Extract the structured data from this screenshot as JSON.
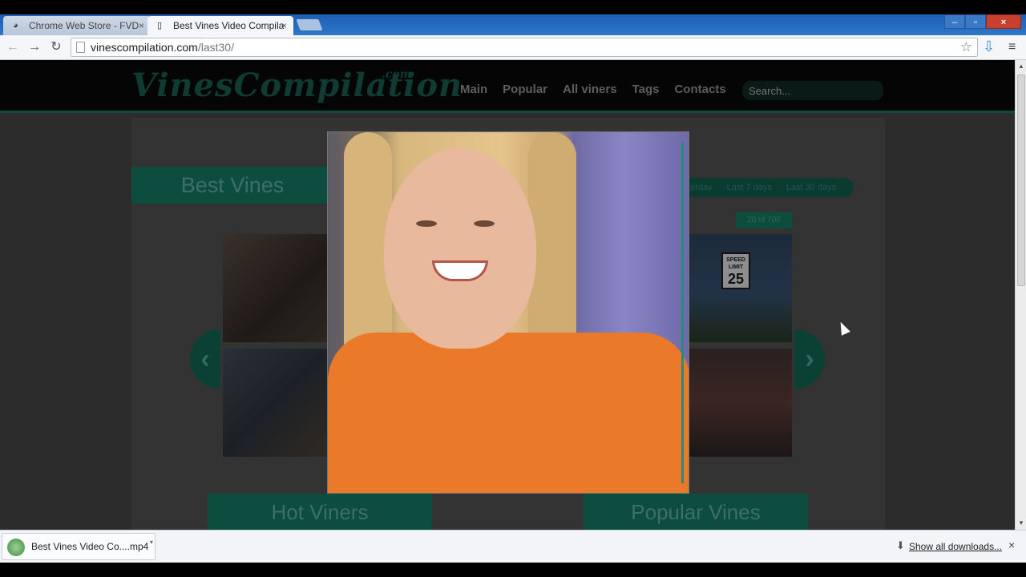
{
  "tabs": [
    {
      "title": "Chrome Web Store - FVD",
      "close": "×"
    },
    {
      "title": "Best Vines Video Compila",
      "close": "×"
    }
  ],
  "window_controls": {
    "minimize": "–",
    "maximize": "▫",
    "close": "×"
  },
  "toolbar": {
    "back": "←",
    "forward": "→",
    "reload": "↻",
    "url_host": "vinescompilation.com",
    "url_path": "/last30/",
    "star": "☆",
    "download": "⇩",
    "menu": "≡"
  },
  "site": {
    "logo": "VinesCompilation",
    "logo_suffix": ".com",
    "nav": [
      "Main",
      "Popular",
      "All viners",
      "Tags",
      "Contacts"
    ],
    "search_placeholder": "Search...",
    "best_vines": "Best Vines",
    "filters": [
      "terday",
      "Last 7 days",
      "Last 30 days"
    ],
    "counter": "20 of 700",
    "arrow_left": "‹",
    "arrow_right": "›",
    "speed_sign_top": "SPEED LIMIT",
    "speed_sign_num": "25",
    "hot_viners": "Hot Viners",
    "popular_vines": "Popular Vines"
  },
  "downloads": {
    "item": "Best Vines Video Co....mp4",
    "dropdown": "▾",
    "show_all": "Show all downloads...",
    "show_all_icon": "⬇",
    "close": "×"
  }
}
